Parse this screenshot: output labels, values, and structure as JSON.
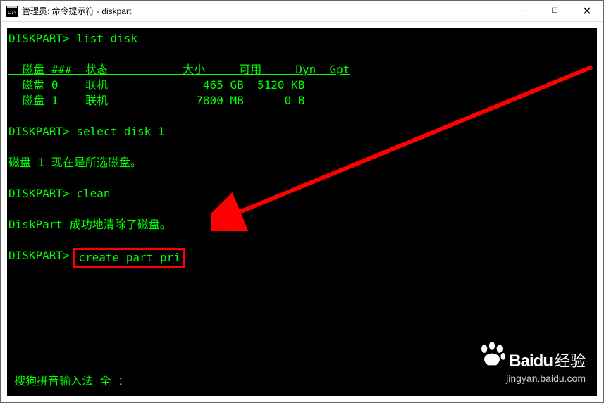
{
  "window": {
    "title": "管理员: 命令提示符 - diskpart",
    "controls": {
      "minimize": "—",
      "maximize": "☐",
      "close": "✕"
    }
  },
  "terminal": {
    "prompt": "DISKPART>",
    "cmd1": " list disk",
    "header": "  磁盘 ###  状态           大小     可用     Dyn  Gpt",
    "header_underline": "  --------  -------------  -------  -------  ---  ---",
    "row0": "  磁盘 0    联机              465 GB  5120 KB        ",
    "row1": "  磁盘 1    联机             7800 MB      0 B        ",
    "cmd2": " select disk 1",
    "msg1": "磁盘 1 现在是所选磁盘。",
    "cmd3": " clean",
    "msg2": "DiskPart 成功地清除了磁盘。",
    "cmd4": "create part pri",
    "ime": "搜狗拼音输入法 全 ："
  },
  "watermark": {
    "brand": "Bai",
    "brand2": "du",
    "brand3": "经验",
    "url": "jingyan.baidu.com"
  }
}
